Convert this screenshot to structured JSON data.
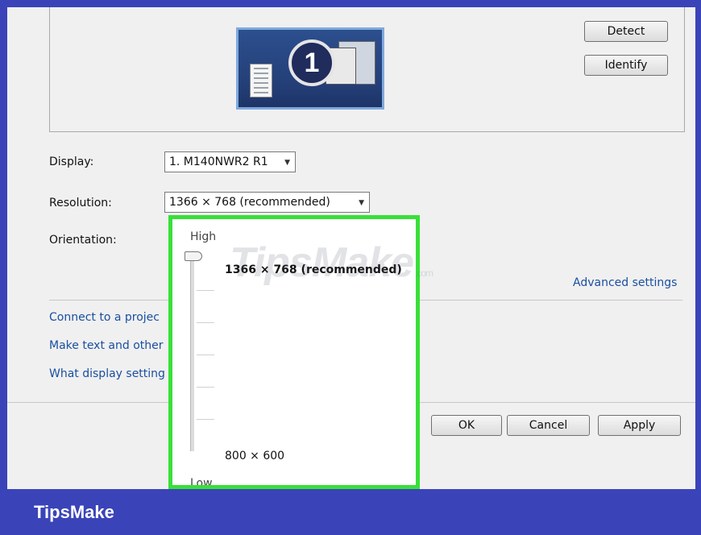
{
  "buttons": {
    "detect": "Detect",
    "identify": "Identify",
    "ok": "OK",
    "cancel": "Cancel",
    "apply": "Apply"
  },
  "monitor": {
    "number": "1"
  },
  "fields": {
    "display_label": "Display:",
    "display_value": "1. M140NWR2 R1",
    "resolution_label": "Resolution:",
    "resolution_value": "1366 × 768 (recommended)",
    "orientation_label": "Orientation:"
  },
  "links": {
    "advanced_settings": "Advanced settings",
    "connect_projector": "Connect to a projec",
    "make_text": "Make text and other",
    "what_display": "What display setting"
  },
  "resolution_popup": {
    "high_label": "High",
    "low_label": "Low",
    "current": "1366 × 768 (recommended)",
    "minimum": "800 × 600",
    "slider_position": "top"
  },
  "watermark": {
    "text": "TipsMake",
    "suffix": ".com"
  },
  "footer": {
    "brand": "TipsMake"
  },
  "colors": {
    "frame_border": "#3a44b8",
    "highlight_border": "#38e038",
    "link": "#1a4fa0",
    "monitor_fill": "#2c4f8e"
  }
}
